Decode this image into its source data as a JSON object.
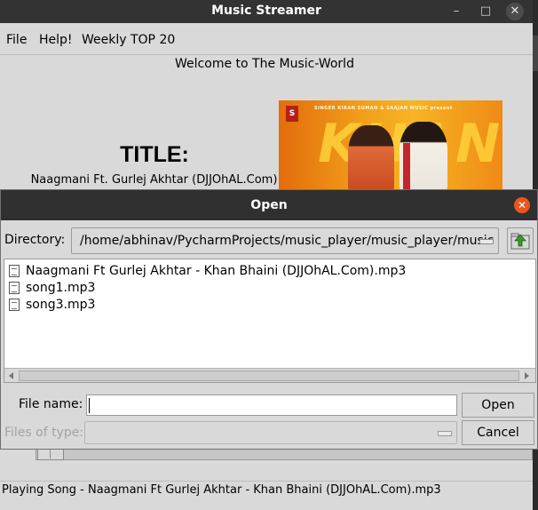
{
  "main_window": {
    "title": "Music Streamer",
    "controls": {
      "minimize": "–",
      "maximize": "□",
      "close": "✕"
    },
    "menu": [
      "File",
      "Help!",
      "Weekly TOP 20"
    ],
    "welcome": "Welcome to The Music-World",
    "title_heading": "TITLE:",
    "song_title": "Naagmani Ft. Gurlej Akhtar (DJJOhAL.Com)",
    "album_art": {
      "logo": "S",
      "top_text": "SINGER KIRAN SUMAN & SAAJAN MUSIC present",
      "big_text": "KHAN"
    },
    "status": "Playing Song - Naagmani Ft Gurlej Akhtar - Khan Bhaini (DJJOhAL.Com).mp3"
  },
  "dialog": {
    "title": "Open",
    "close_glyph": "✕",
    "directory_label": "Directory:",
    "directory_value": "/home/abhinav/PycharmProjects/music_player/music_player/music",
    "files": [
      "Naagmani Ft Gurlej Akhtar - Khan Bhaini (DJJOhAL.Com).mp3",
      "song1.mp3",
      "song3.mp3"
    ],
    "file_name_label": "File name:",
    "file_name_value": "",
    "files_of_type_label": "Files of type:",
    "open_button": "Open",
    "cancel_button": "Cancel"
  },
  "colors": {
    "window_bg": "#d9d9d9",
    "titlebar": "#333333",
    "dialog_close": "#e9541f",
    "folder_up_icon": "#3a9a2a"
  }
}
